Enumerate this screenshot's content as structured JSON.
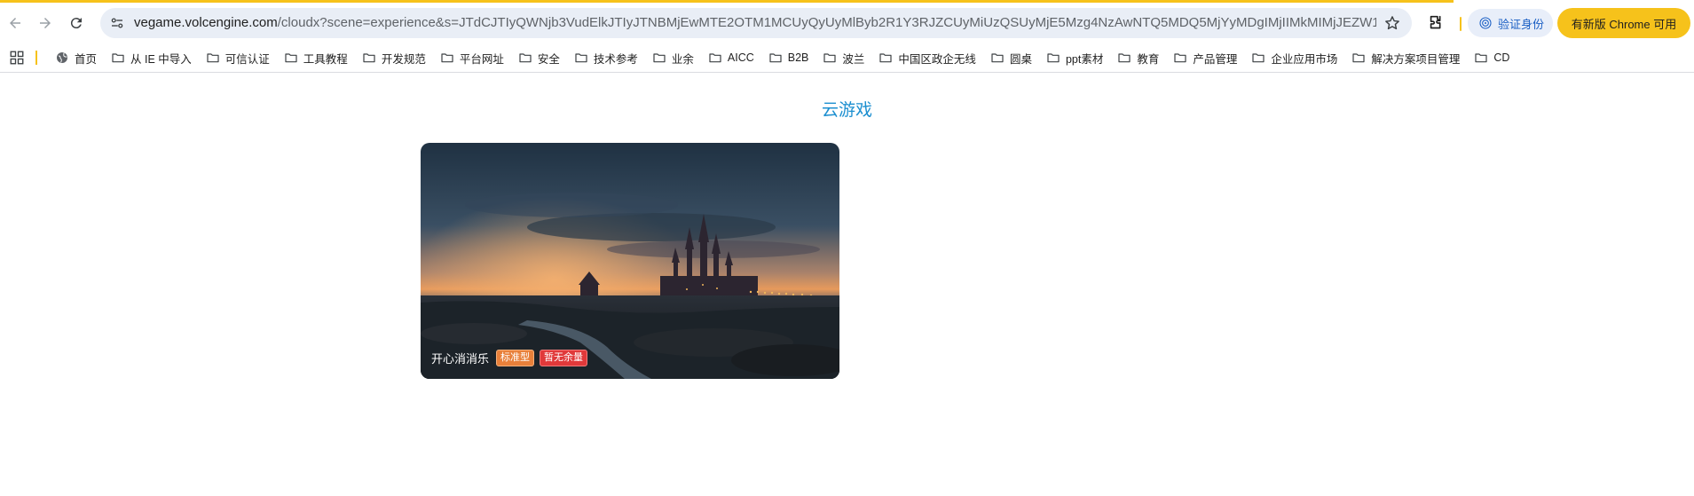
{
  "browser": {
    "url_domain": "vegame.volcengine.com",
    "url_path": "/cloudx?scene=experience&s=JTdCJTIyQWNjb3VudElkJTIyJTNBMjEwMTE2OTM1MCUyQyUyMlByb2R1Y3RJZCUyMiUzQSUyMjE5Mzg4NzAwNTQ5MDQ5MjYyMDgIMjIIMkMIMjJEZW1v...",
    "profile_label": "验证身份",
    "update_label": "有新版 Chrome 可用",
    "accent_color": "#f6c21b"
  },
  "bookmarks": [
    {
      "label": "首页",
      "icon": "globe-icon"
    },
    {
      "label": "从 IE 中导入",
      "icon": "folder-icon"
    },
    {
      "label": "可信认证",
      "icon": "folder-icon"
    },
    {
      "label": "工具教程",
      "icon": "folder-icon"
    },
    {
      "label": "开发规范",
      "icon": "folder-icon"
    },
    {
      "label": "平台网址",
      "icon": "folder-icon"
    },
    {
      "label": "安全",
      "icon": "folder-icon"
    },
    {
      "label": "技术参考",
      "icon": "folder-icon"
    },
    {
      "label": "业余",
      "icon": "folder-icon"
    },
    {
      "label": "AICC",
      "icon": "folder-icon"
    },
    {
      "label": "B2B",
      "icon": "folder-icon"
    },
    {
      "label": "波兰",
      "icon": "folder-icon"
    },
    {
      "label": "中国区政企无线",
      "icon": "folder-icon"
    },
    {
      "label": "圆桌",
      "icon": "folder-icon"
    },
    {
      "label": "ppt素材",
      "icon": "folder-icon"
    },
    {
      "label": "教育",
      "icon": "folder-icon"
    },
    {
      "label": "产品管理",
      "icon": "folder-icon"
    },
    {
      "label": "企业应用市场",
      "icon": "folder-icon"
    },
    {
      "label": "解决方案项目管理",
      "icon": "folder-icon"
    },
    {
      "label": "CD",
      "icon": "folder-icon"
    }
  ],
  "page": {
    "title": "云游戏",
    "title_color": "#1c8fd0",
    "games": [
      {
        "name": "开心消消乐",
        "type_tag": "标准型",
        "status_tag": "暂无余量",
        "type_color": "#e8803a",
        "status_color": "#e0393a"
      }
    ]
  }
}
